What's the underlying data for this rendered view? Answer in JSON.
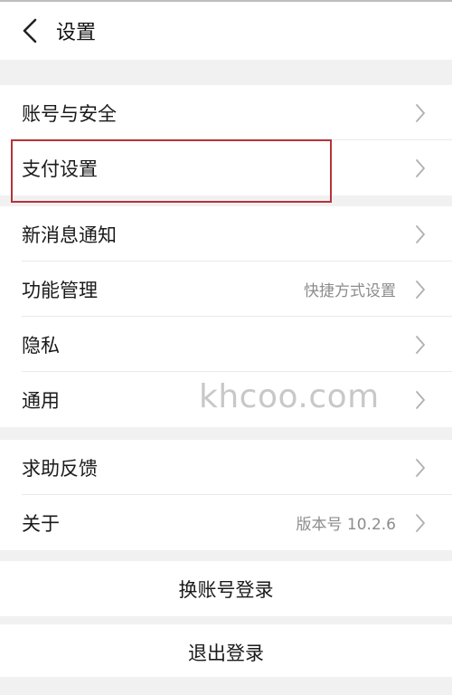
{
  "header": {
    "title": "设置",
    "back_icon": "chevron-left-icon"
  },
  "groups": [
    {
      "items": [
        {
          "label": "账号与安全",
          "sub": ""
        },
        {
          "label": "支付设置",
          "sub": ""
        }
      ]
    },
    {
      "items": [
        {
          "label": "新消息通知",
          "sub": ""
        },
        {
          "label": "功能管理",
          "sub": "快捷方式设置"
        },
        {
          "label": "隐私",
          "sub": ""
        },
        {
          "label": "通用",
          "sub": ""
        }
      ]
    },
    {
      "items": [
        {
          "label": "求助反馈",
          "sub": ""
        },
        {
          "label": "关于",
          "sub": "版本号 10.2.6"
        }
      ]
    }
  ],
  "actions": {
    "switch_account": "换账号登录",
    "logout": "退出登录"
  },
  "highlight": {
    "target": "支付设置",
    "color": "#b5333a"
  },
  "watermark": "khcoo.com"
}
